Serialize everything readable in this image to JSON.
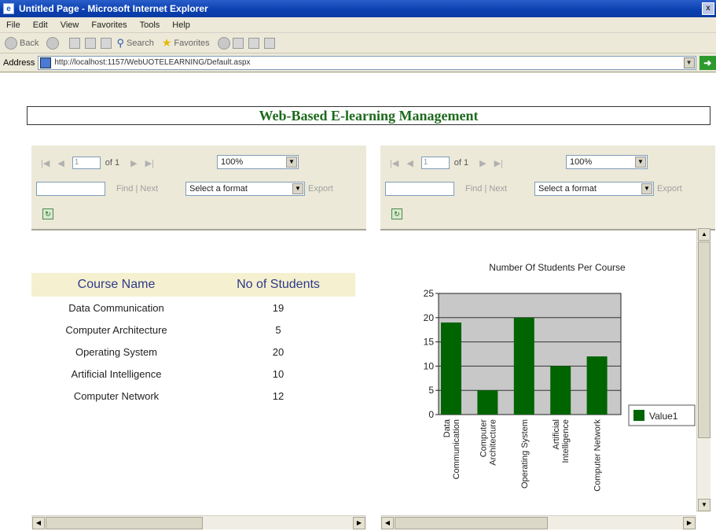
{
  "window": {
    "title": "Untitled Page - Microsoft Internet Explorer",
    "close_label": "x"
  },
  "menu": [
    "File",
    "Edit",
    "View",
    "Favorites",
    "Tools",
    "Help"
  ],
  "toolbar": {
    "back_label": "Back",
    "search_label": "Search",
    "favorites_label": "Favorites"
  },
  "address": {
    "label": "Address",
    "url": "http://localhost:1157/WebUOTELEARNING/Default.aspx",
    "go_icon": "go-arrow-icon"
  },
  "page": {
    "title": "Web-Based E-learning Management"
  },
  "report_viewer": {
    "page_value": "1",
    "of_text": "of 1",
    "zoom": "100%",
    "find_label": "Find",
    "separator": "|",
    "next_label": "Next",
    "format_placeholder": "Select a format",
    "export_label": "Export",
    "first_icon": "first-page-icon",
    "prev_icon": "prev-page-icon",
    "next_icon": "next-page-icon",
    "last_icon": "last-page-icon",
    "refresh_icon": "refresh-icon"
  },
  "table": {
    "headers": [
      "Course Name",
      "No of Students"
    ],
    "rows": [
      [
        "Data Communication",
        "19"
      ],
      [
        "Computer Architecture",
        "5"
      ],
      [
        "Operating System",
        "20"
      ],
      [
        "Artificial Intelligence",
        "10"
      ],
      [
        "Computer Network",
        "12"
      ]
    ]
  },
  "colors": {
    "title_green": "#1d6b1d",
    "bar_green": "#006400",
    "panel_bg": "#ece9d8",
    "header_bg": "#f5f0cf"
  },
  "chart_data": {
    "type": "bar",
    "title": "Number Of Students Per Course",
    "categories": [
      "Data Communication",
      "Computer Architecture",
      "Operating System",
      "Artificial Intelligence",
      "Computer Network"
    ],
    "category_lines": [
      [
        "Data",
        "Communication"
      ],
      [
        "Computer",
        "Architecture"
      ],
      [
        "Operating System"
      ],
      [
        "Artificial",
        "Intelligence"
      ],
      [
        "Computer Network"
      ]
    ],
    "series": [
      {
        "name": "Value1",
        "values": [
          19,
          5,
          20,
          10,
          12
        ]
      }
    ],
    "ylim": [
      0,
      25
    ],
    "yticks": [
      0,
      5,
      10,
      15,
      20,
      25
    ],
    "grid": true,
    "legend": "right",
    "xlabel": "",
    "ylabel": ""
  }
}
